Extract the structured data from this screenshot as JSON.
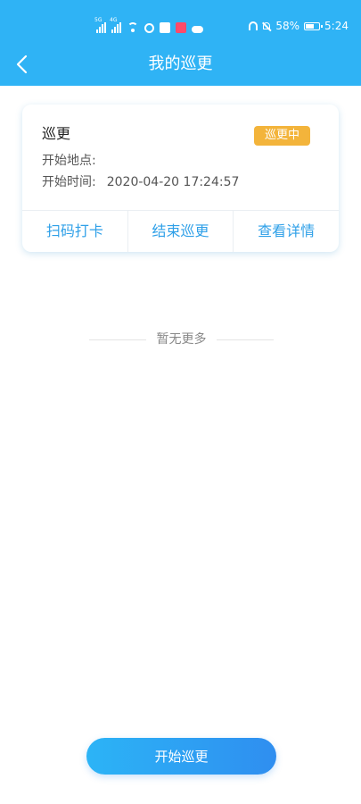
{
  "status_bar": {
    "signal_1_tag": "5G",
    "signal_2_tag": "4G",
    "battery": "58%",
    "time": "5:24",
    "app_icon_colors": [
      "#ffffff",
      "#ff4a6a"
    ]
  },
  "header": {
    "title": "我的巡更",
    "back_icon": "chevron-left-icon"
  },
  "patrol_card": {
    "title": "巡更",
    "status": "巡更中",
    "status_color": "#f3b43b",
    "start_location_label": "开始地点:",
    "start_location_value": "",
    "start_time_label": "开始时间:",
    "start_time_value": "2020-04-20 17:24:57",
    "actions": [
      "扫码打卡",
      "结束巡更",
      "查看详情"
    ]
  },
  "list_footer": "暂无更多",
  "start_button": "开始巡更",
  "colors": {
    "primary": "#2fb3f5",
    "action_text": "#2fa0e8"
  }
}
